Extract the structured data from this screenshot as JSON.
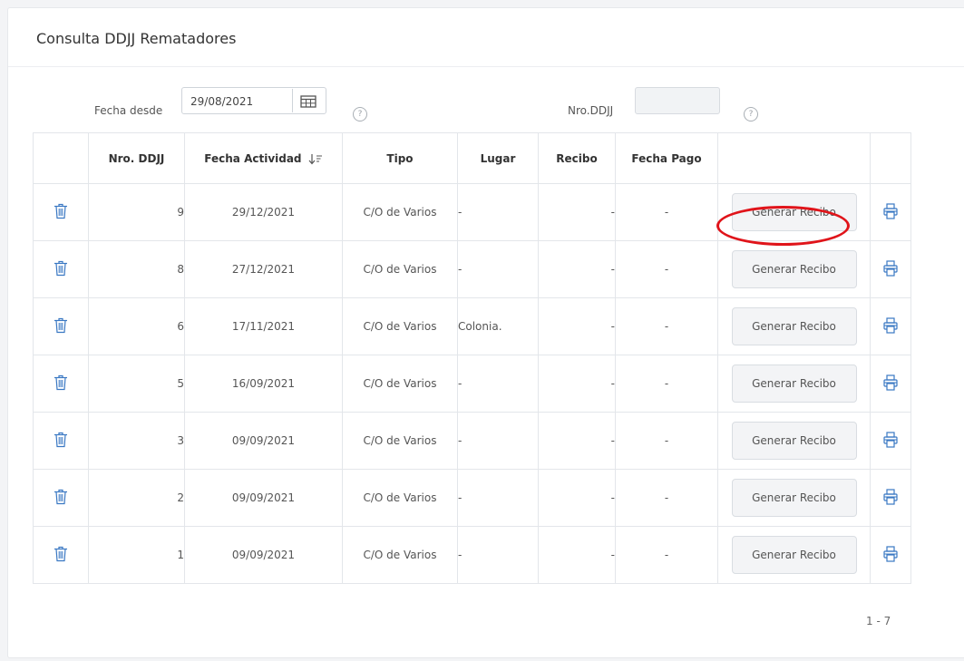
{
  "page": {
    "title": "Consulta DDJJ Rematadores"
  },
  "filters": {
    "fecha_desde_label": "Fecha desde",
    "fecha_desde_value": "29/08/2021",
    "nro_ddjj_label": "Nro.DDJJ",
    "nro_ddjj_value": "",
    "help_glyph": "?"
  },
  "table": {
    "columns": [
      "",
      "Nro. DDJJ",
      "Fecha Actividad",
      "Tipo",
      "Lugar",
      "Recibo",
      "Fecha Pago",
      "",
      ""
    ],
    "rows": [
      {
        "nro": "9",
        "fecha": "29/12/2021",
        "tipo": "C/O de Varios",
        "lugar": "-",
        "recibo": "-",
        "fecha_pago": "-",
        "action": "Generar Recibo"
      },
      {
        "nro": "8",
        "fecha": "27/12/2021",
        "tipo": "C/O de Varios",
        "lugar": "-",
        "recibo": "-",
        "fecha_pago": "-",
        "action": "Generar Recibo"
      },
      {
        "nro": "6",
        "fecha": "17/11/2021",
        "tipo": "C/O de Varios",
        "lugar": "Colonia.",
        "recibo": "-",
        "fecha_pago": "-",
        "action": "Generar Recibo"
      },
      {
        "nro": "5",
        "fecha": "16/09/2021",
        "tipo": "C/O de Varios",
        "lugar": "-",
        "recibo": "-",
        "fecha_pago": "-",
        "action": "Generar Recibo"
      },
      {
        "nro": "3",
        "fecha": "09/09/2021",
        "tipo": "C/O de Varios",
        "lugar": "-",
        "recibo": "-",
        "fecha_pago": "-",
        "action": "Generar Recibo"
      },
      {
        "nro": "2",
        "fecha": "09/09/2021",
        "tipo": "C/O de Varios",
        "lugar": "-",
        "recibo": "-",
        "fecha_pago": "-",
        "action": "Generar Recibo"
      },
      {
        "nro": "1",
        "fecha": "09/09/2021",
        "tipo": "C/O de Varios",
        "lugar": "-",
        "recibo": "-",
        "fecha_pago": "-",
        "action": "Generar Recibo"
      }
    ]
  },
  "pagination": {
    "range": "1 - 7"
  },
  "colors": {
    "link": "#3a78c3",
    "highlight": "#e0141a"
  },
  "icons": {
    "delete": "trash-icon",
    "print": "printer-icon",
    "calendar": "calendar-icon",
    "sort": "sort-desc-icon"
  }
}
